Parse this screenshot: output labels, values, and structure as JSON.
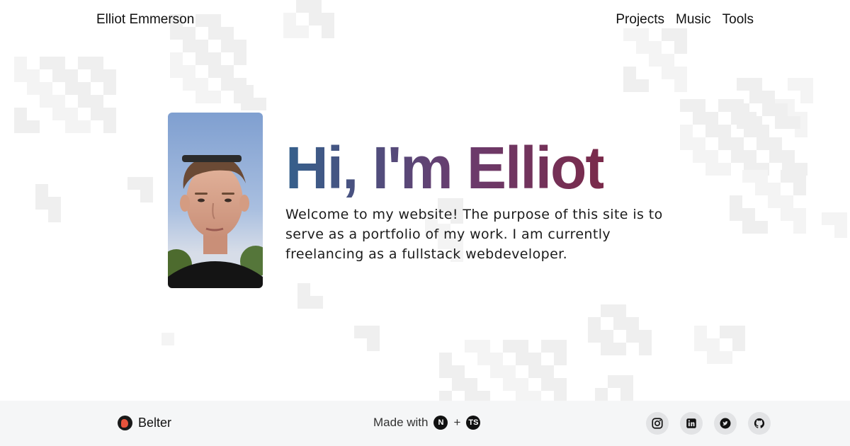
{
  "header": {
    "brand": "Elliot Emmerson",
    "nav": [
      "Projects",
      "Music",
      "Tools"
    ]
  },
  "hero": {
    "title": "Hi, I'm Elliot",
    "intro": "Welcome to my website! The purpose of this site is to serve as a portfolio of my work. I am currently freelancing as a fullstack webdeveloper.",
    "gradient_colors": [
      "#35608c",
      "#6a3c6e",
      "#7a2a4a"
    ]
  },
  "footer": {
    "brand": "Belter",
    "made_with": "Made with",
    "plus": "+",
    "tech_badges": [
      "N",
      "TS"
    ],
    "social_icons": [
      "instagram-icon",
      "linkedin-icon",
      "twitter-icon",
      "github-icon"
    ]
  }
}
